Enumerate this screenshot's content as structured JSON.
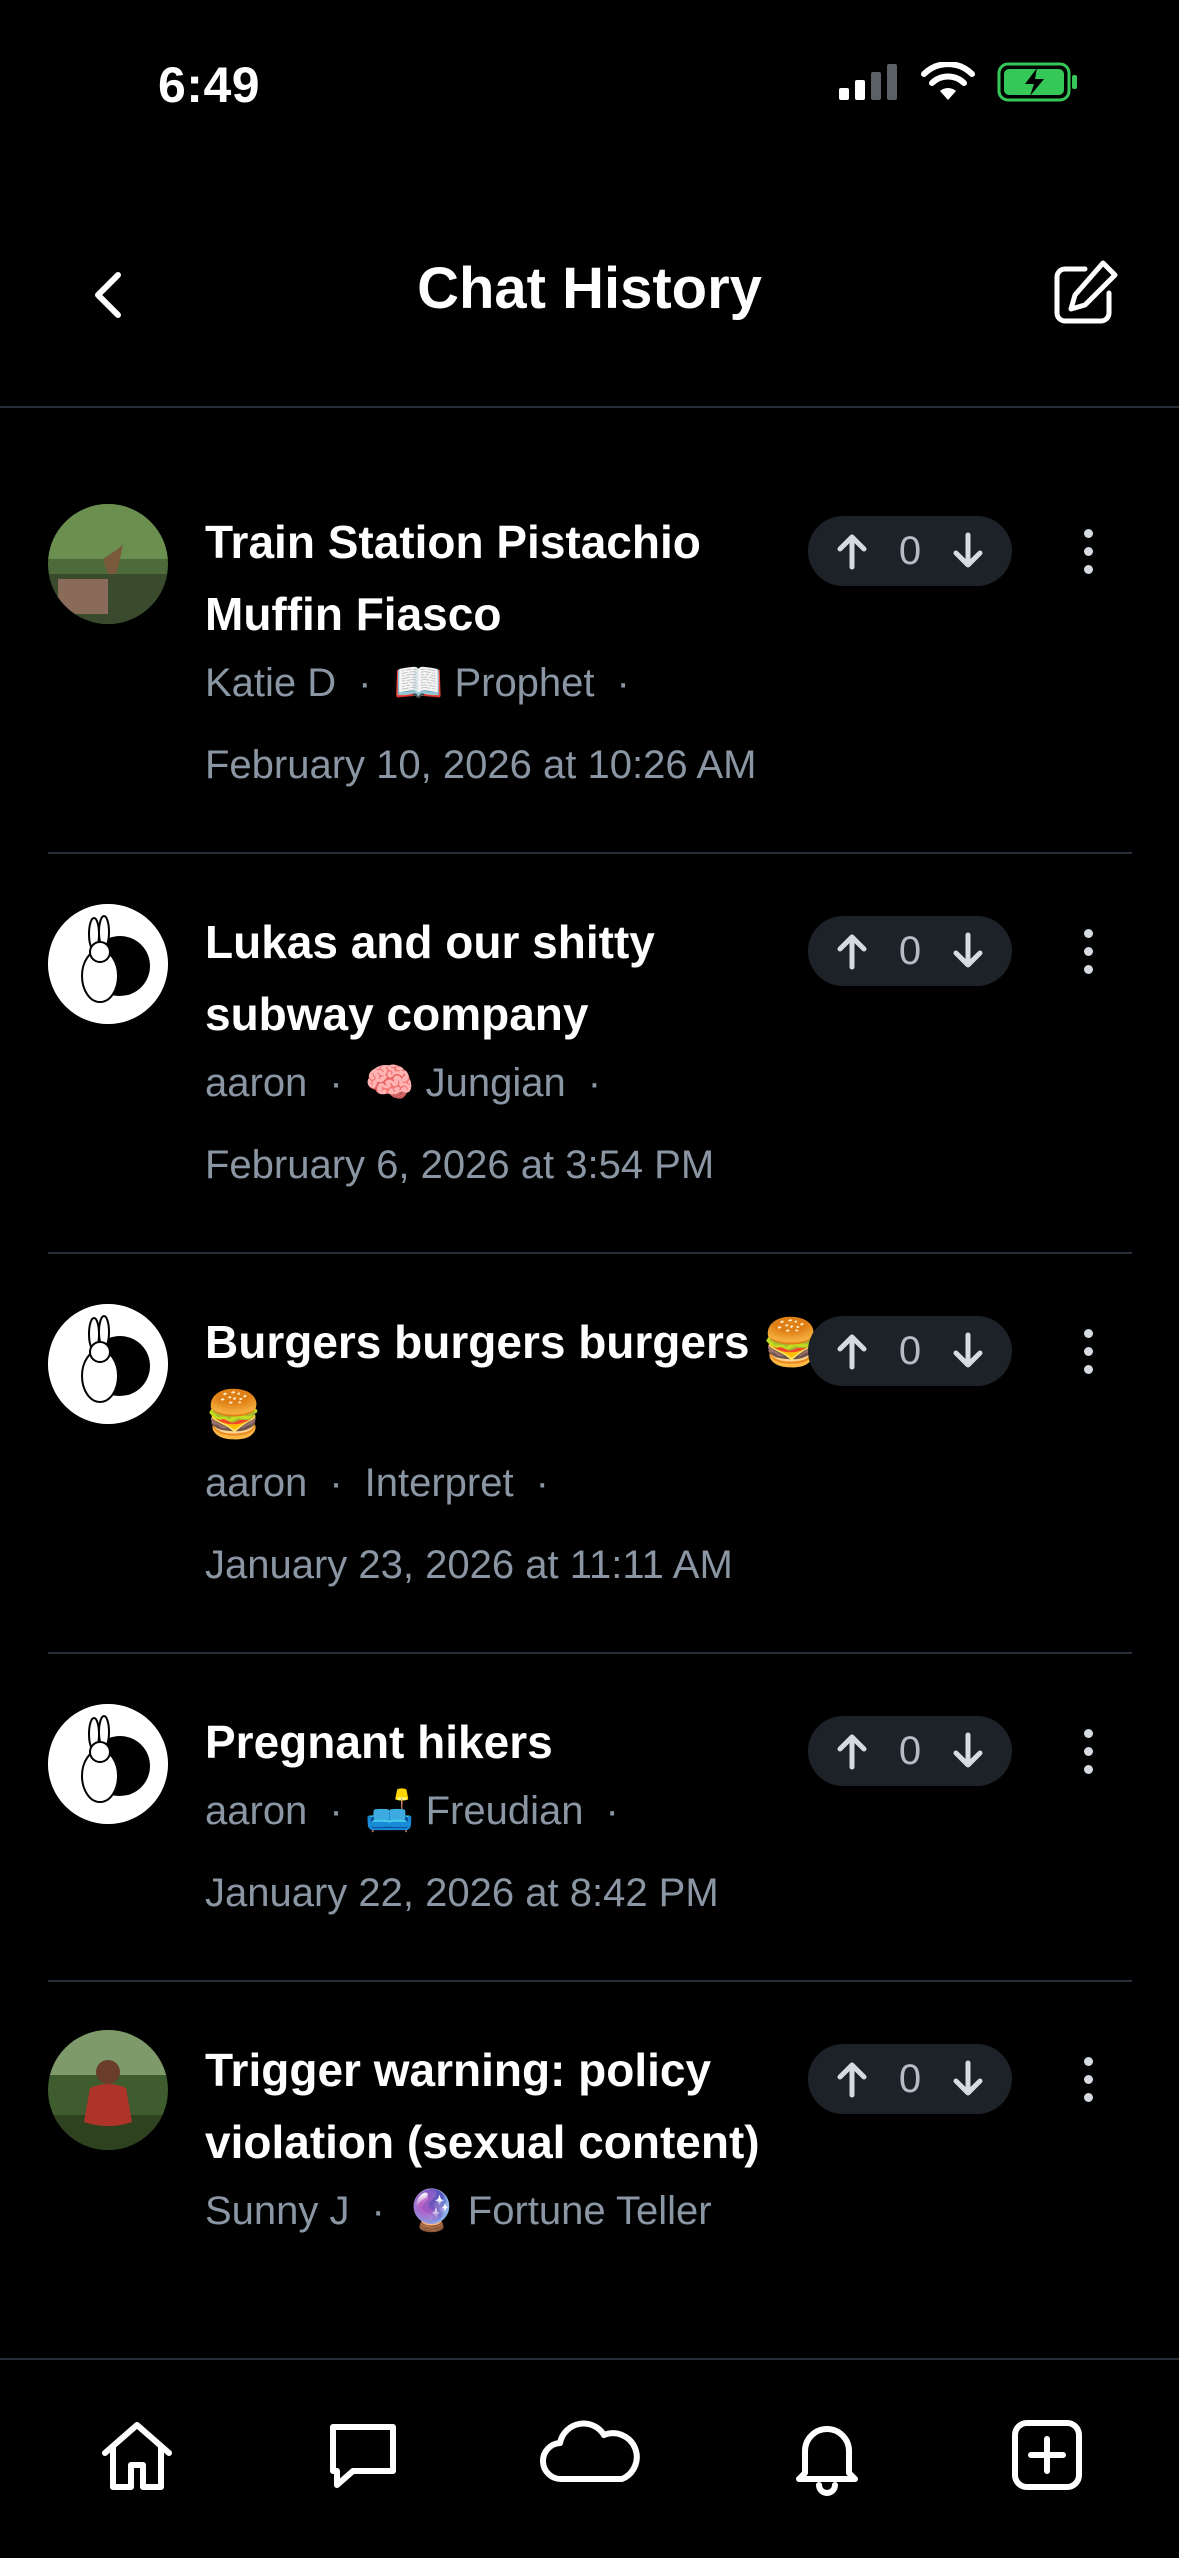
{
  "status_bar": {
    "time": "6:49",
    "icons": [
      "signal-icon",
      "wifi-icon",
      "battery-charging-icon"
    ]
  },
  "header": {
    "title": "Chat History",
    "back_icon": "chevron-left-icon",
    "compose_icon": "compose-icon"
  },
  "conversations": [
    {
      "title": "Train Station Pistachio Muffin Fiasco",
      "user": "Katie D",
      "mode_emoji": "📖",
      "mode": "Prophet",
      "date": "February 10, 2026 at 10:26 AM",
      "votes": "0",
      "avatar": "photo-deer"
    },
    {
      "title": "Lukas and our shitty subway company",
      "user": "aaron",
      "mode_emoji": "🧠",
      "mode": "Jungian",
      "date": "February 6, 2026 at 3:54 PM",
      "votes": "0",
      "avatar": "yin-yang-rabbit"
    },
    {
      "title": "Burgers burgers burgers 🍔🍔",
      "user": "aaron",
      "mode_emoji": "",
      "mode": "Interpret",
      "date": "January 23, 2026 at 11:11 AM",
      "votes": "0",
      "avatar": "yin-yang-rabbit"
    },
    {
      "title": "Pregnant hikers",
      "user": "aaron",
      "mode_emoji": "🛋️",
      "mode": "Freudian",
      "date": "January 22, 2026 at 8:42 PM",
      "votes": "0",
      "avatar": "yin-yang-rabbit"
    },
    {
      "title": "Trigger warning: policy violation (sexual content)",
      "user": "Sunny J",
      "mode_emoji": "🔮",
      "mode": "Fortune Teller",
      "date": "",
      "votes": "0",
      "avatar": "photo-person"
    }
  ],
  "tab_bar": [
    "home-icon",
    "chat-icon",
    "cloud-icon",
    "bell-icon",
    "plus-square-icon"
  ]
}
